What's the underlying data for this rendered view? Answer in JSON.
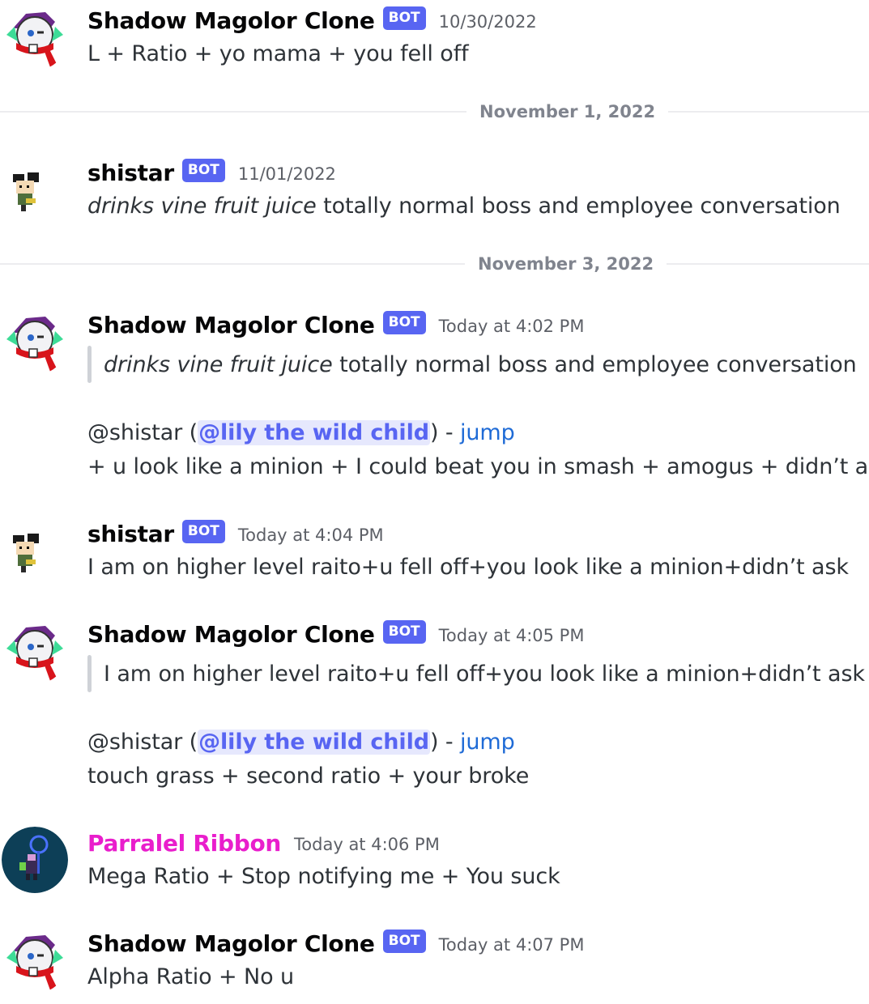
{
  "messages": [
    {
      "author": "Shadow Magolor Clone",
      "bot_tag": "BOT",
      "time": "10/30/2022",
      "lines": [
        "L + Ratio + yo mama + you fell off"
      ]
    },
    {
      "author": "shistar",
      "bot_tag": "BOT",
      "time": "11/01/2022",
      "italic": "drinks vine fruit juice",
      "rest": " totally normal boss and employee conversation"
    },
    {
      "author": "Shadow Magolor Clone",
      "bot_tag": "BOT",
      "time": "Today at 4:02 PM",
      "quote_italic": "drinks vine fruit juice",
      "quote_rest": " totally normal boss and employee conversation",
      "reply_prefix": "@shistar (",
      "mention": "@lily the wild child",
      "reply_mid": ") - ",
      "jump": "jump",
      "body": " + u look like a minion + I could beat you in smash + amogus + didn’t ask"
    },
    {
      "author": "shistar",
      "bot_tag": "BOT",
      "time": "Today at 4:04 PM",
      "body": "I am on higher level raito+u fell off+you look like a minion+didn’t ask"
    },
    {
      "author": "Shadow Magolor Clone",
      "bot_tag": "BOT",
      "time": "Today at 4:05 PM",
      "quote": "I am on higher level raito+u fell off+you look like a minion+didn’t ask",
      "reply_prefix": "@shistar (",
      "mention": "@lily the wild child",
      "reply_mid": ") - ",
      "jump": "jump",
      "body": " touch grass + second ratio + your broke"
    },
    {
      "author": "Parralel Ribbon",
      "time": "Today at 4:06 PM",
      "body": "Mega Ratio + Stop notifying me + You suck"
    },
    {
      "author": "Shadow Magolor Clone",
      "bot_tag": "BOT",
      "time": "Today at 4:07 PM",
      "body": "Alpha Ratio + No u"
    }
  ],
  "dividers": [
    "November 1, 2022",
    "November 3, 2022"
  ],
  "colors": {
    "bot_tag": "#5865f2",
    "parralel_author": "#e91ecc",
    "mention": "#5865f2",
    "link": "#1f6bd6"
  },
  "icons": {
    "magolor": "magolor-avatar-icon",
    "shistar": "shistar-avatar-icon",
    "ribbon": "ribbon-avatar-icon"
  }
}
